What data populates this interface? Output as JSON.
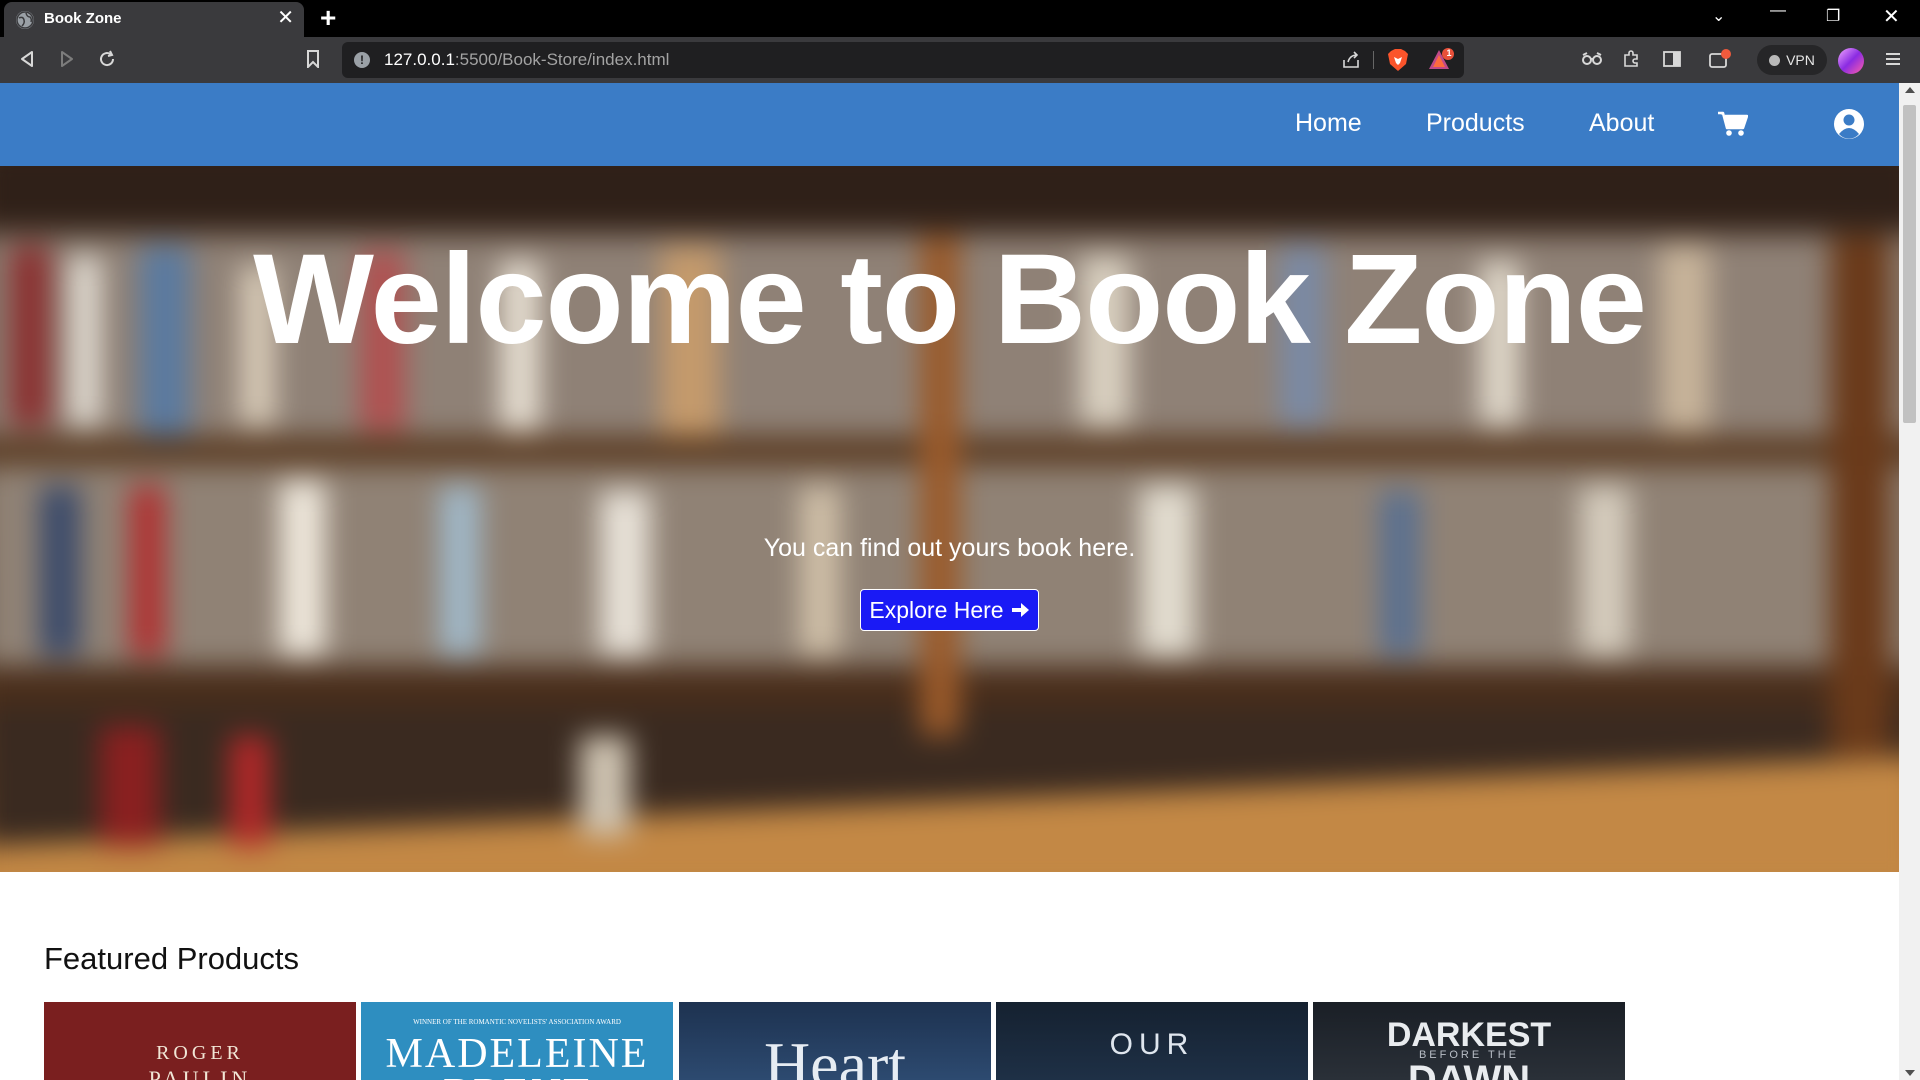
{
  "browser": {
    "tab_title": "Book Zone",
    "url_host": "127.0.0.1",
    "url_rest": ":5500/Book-Store/index.html",
    "vpn_label": "VPN",
    "notification_count": "1"
  },
  "nav": {
    "links": [
      "Home",
      "Products",
      "About"
    ],
    "icons": [
      "cart-icon",
      "user-circle-icon"
    ]
  },
  "hero": {
    "title": "Welcome to Book Zone",
    "subtitle": "You can find out yours book here.",
    "button_label": "Explore Here"
  },
  "featured": {
    "title": "Featured Products",
    "covers": [
      {
        "top_text": "ROGER",
        "second_text": "PAULIN"
      },
      {
        "tag_text": "WINNER OF THE ROMANTIC NOVELISTS' ASSOCIATION AWARD",
        "top_text": "MADELEINE",
        "second_text": "BRENT"
      },
      {
        "top_text": "Heart"
      },
      {
        "top_text": "OUR"
      },
      {
        "top_text": "DARKEST",
        "small_text": "BEFORE THE",
        "second_text": "DAWN"
      }
    ]
  },
  "colors": {
    "navbar": "#3b7cc6",
    "button": "#1a1af5"
  }
}
